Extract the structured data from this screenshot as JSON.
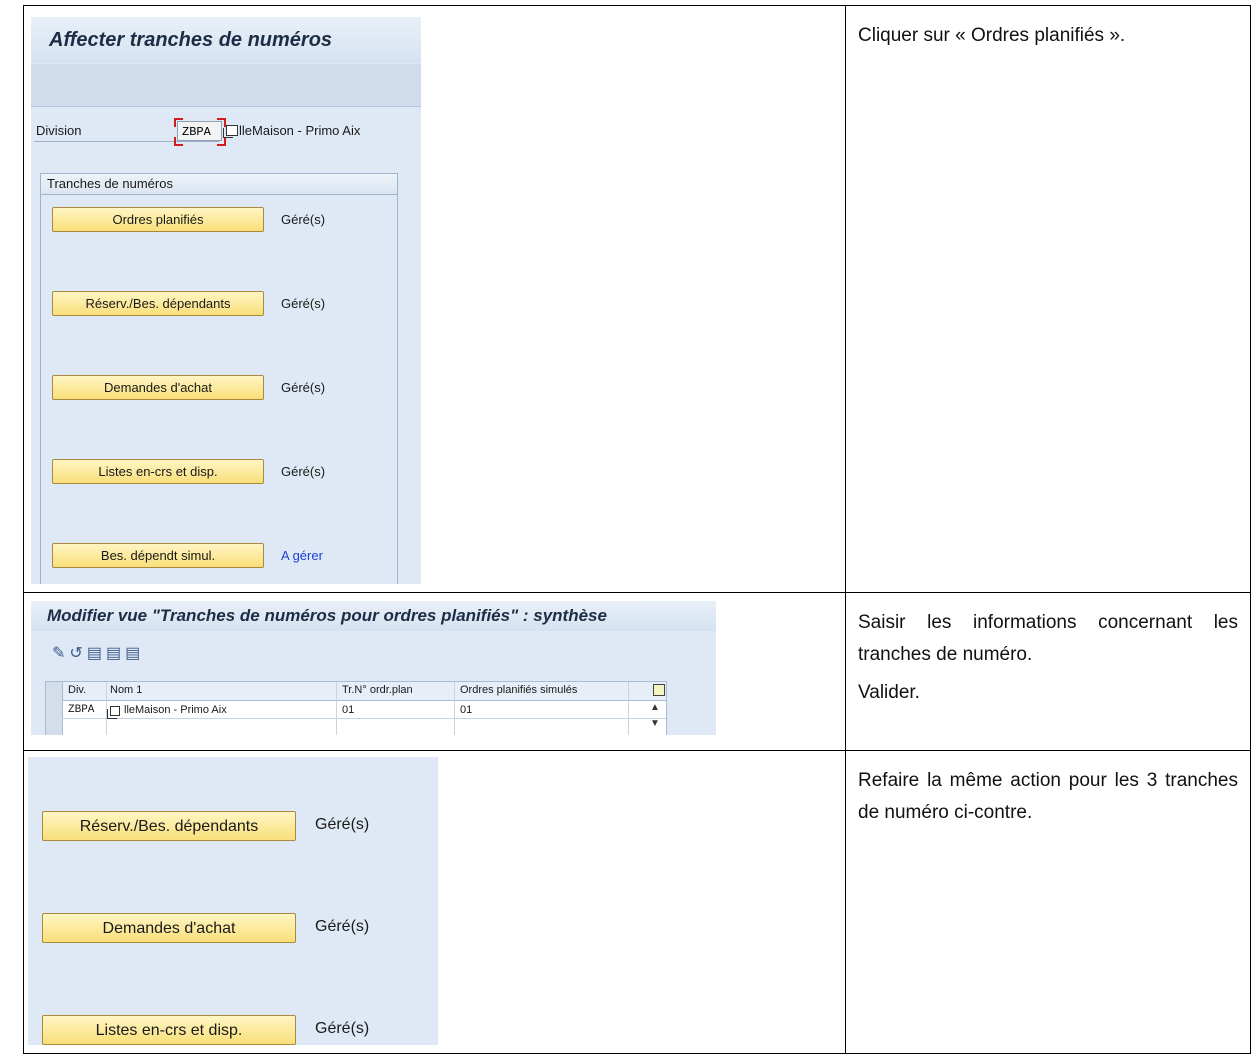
{
  "rows": [
    {
      "instruction": "Cliquer sur « Ordres planifiés ».",
      "sap": {
        "title": "Affecter tranches de numéros",
        "division_label": "Division",
        "division_value": "ZBPA",
        "division_name": "lleMaison - Primo Aix",
        "group_title": "Tranches de numéros",
        "buttons": [
          {
            "label": "Ordres planifiés",
            "status": "Géré(s)"
          },
          {
            "label": "Réserv./Bes. dépendants",
            "status": "Géré(s)"
          },
          {
            "label": "Demandes d'achat",
            "status": "Géré(s)"
          },
          {
            "label": "Listes en-crs et disp.",
            "status": "Géré(s)"
          },
          {
            "label": "Bes. dépendt simul.",
            "status": "A gérer",
            "status_color": "#1d3ed6"
          }
        ]
      }
    },
    {
      "instruction": [
        "Saisir les informations concernant les tranches de numéro.",
        "Valider."
      ],
      "sap": {
        "title": "Modifier vue \"Tranches de numéros pour ordres planifiés\" : synthèse",
        "toolbar_icons": [
          "change-display-icon",
          "undo-icon",
          "save-icon",
          "select-all-icon",
          "deselect-icon"
        ],
        "columns": [
          "Div.",
          "Nom 1",
          "Tr.N° ordr.plan",
          "Ordres planifiés simulés"
        ],
        "row": {
          "div": "ZBPA",
          "nom": "lleMaison - Primo Aix",
          "tr": "01",
          "sim": "01"
        }
      }
    },
    {
      "instruction": "Refaire la même action pour les 3 tranches de numéro ci-contre.",
      "sap": {
        "buttons": [
          {
            "label": "Réserv./Bes. dépendants",
            "status": "Géré(s)"
          },
          {
            "label": "Demandes d'achat",
            "status": "Géré(s)"
          },
          {
            "label": "Listes en-crs et disp.",
            "status": "Géré(s)"
          }
        ]
      }
    }
  ]
}
